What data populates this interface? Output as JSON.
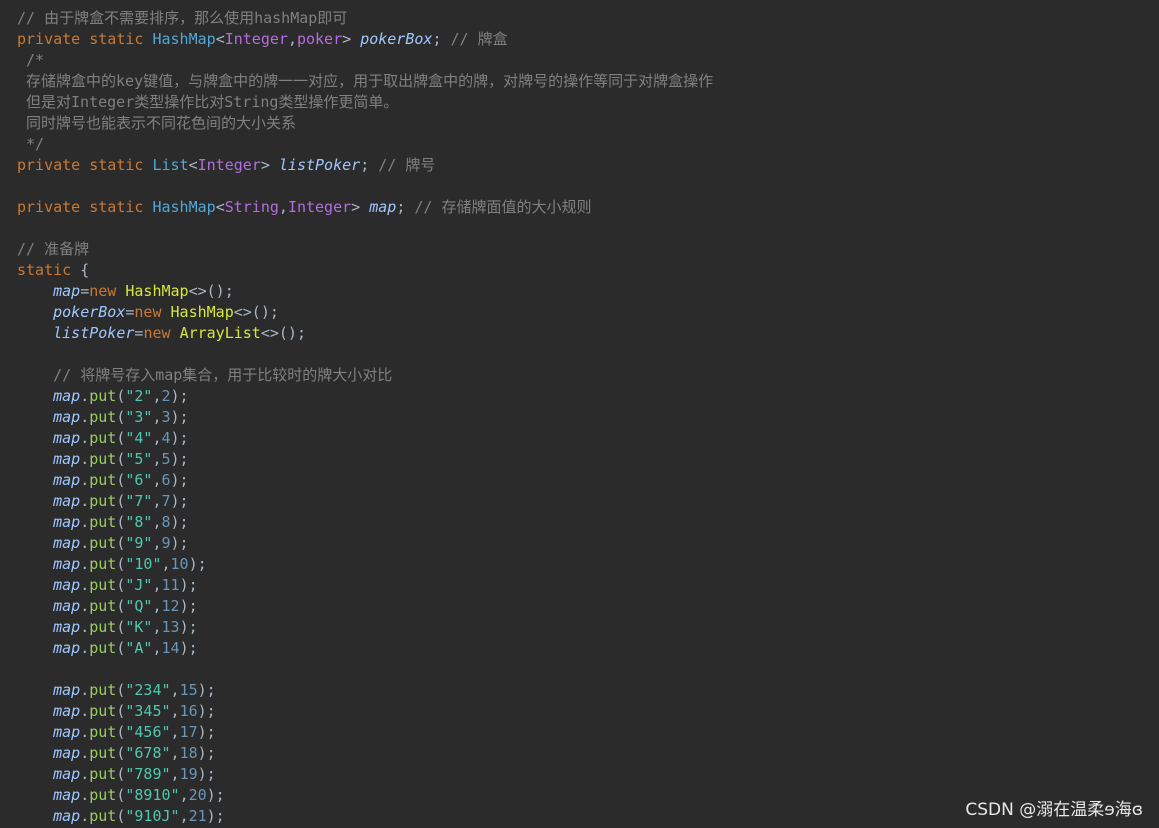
{
  "colors": {
    "background": "#2b2b2b",
    "comment": "#808080",
    "keyword": "#cc7832",
    "type": "#4fa8d8",
    "generic": "#b36ddf",
    "field": "#9fc7ff",
    "method": "#9ccc65",
    "string": "#4ec9b0",
    "number": "#6897bb",
    "ctor": "#d6e83b",
    "plain": "#a9b7c6"
  },
  "watermark": "CSDN @溺在温柔ɘ海ɞ",
  "code_lines": [
    [
      [
        "comment",
        "// 由于牌盒不需要排序，那么使用hashMap即可"
      ]
    ],
    [
      [
        "kw",
        "private static "
      ],
      [
        "type",
        "HashMap"
      ],
      [
        "op",
        "<"
      ],
      [
        "generic",
        "Integer"
      ],
      [
        "op",
        ","
      ],
      [
        "generic",
        "poker"
      ],
      [
        "op",
        "> "
      ],
      [
        "field",
        "pokerBox"
      ],
      [
        "op",
        "; "
      ],
      [
        "comment",
        "// 牌盒"
      ]
    ],
    [
      [
        "comment",
        " /*"
      ]
    ],
    [
      [
        "comment",
        " 存储牌盒中的key键值，与牌盒中的牌一一对应，用于取出牌盒中的牌，对牌号的操作等同于对牌盒操作"
      ]
    ],
    [
      [
        "comment",
        " 但是对Integer类型操作比对String类型操作更简单。"
      ]
    ],
    [
      [
        "comment",
        " 同时牌号也能表示不同花色间的大小关系"
      ]
    ],
    [
      [
        "comment",
        " */"
      ]
    ],
    [
      [
        "kw",
        "private static "
      ],
      [
        "type",
        "List"
      ],
      [
        "op",
        "<"
      ],
      [
        "generic",
        "Integer"
      ],
      [
        "op",
        "> "
      ],
      [
        "field",
        "listPoker"
      ],
      [
        "op",
        "; "
      ],
      [
        "comment",
        "// 牌号"
      ]
    ],
    [],
    [
      [
        "kw",
        "private static "
      ],
      [
        "type",
        "HashMap"
      ],
      [
        "op",
        "<"
      ],
      [
        "generic",
        "String"
      ],
      [
        "op",
        ","
      ],
      [
        "generic",
        "Integer"
      ],
      [
        "op",
        "> "
      ],
      [
        "field",
        "map"
      ],
      [
        "op",
        "; "
      ],
      [
        "comment",
        "// 存储牌面值的大小规则"
      ]
    ],
    [],
    [
      [
        "comment",
        "// 准备牌"
      ]
    ],
    [
      [
        "kw",
        "static "
      ],
      [
        "op",
        "{"
      ]
    ],
    [
      [
        "op",
        "    "
      ],
      [
        "field",
        "map"
      ],
      [
        "op",
        "="
      ],
      [
        "kw",
        "new "
      ],
      [
        "ctor",
        "HashMap"
      ],
      [
        "op",
        "<>();"
      ]
    ],
    [
      [
        "op",
        "    "
      ],
      [
        "field",
        "pokerBox"
      ],
      [
        "op",
        "="
      ],
      [
        "kw",
        "new "
      ],
      [
        "ctor",
        "HashMap"
      ],
      [
        "op",
        "<>();"
      ]
    ],
    [
      [
        "op",
        "    "
      ],
      [
        "field",
        "listPoker"
      ],
      [
        "op",
        "="
      ],
      [
        "kw",
        "new "
      ],
      [
        "ctor",
        "ArrayList"
      ],
      [
        "op",
        "<>();"
      ]
    ],
    [],
    [
      [
        "op",
        "    "
      ],
      [
        "comment",
        "// 将牌号存入map集合，用于比较时的牌大小对比"
      ]
    ],
    [
      [
        "op",
        "    "
      ],
      [
        "field",
        "map"
      ],
      [
        "op",
        "."
      ],
      [
        "method",
        "put"
      ],
      [
        "op",
        "("
      ],
      [
        "string",
        "\"2\""
      ],
      [
        "op",
        ","
      ],
      [
        "number",
        "2"
      ],
      [
        "op",
        ");"
      ]
    ],
    [
      [
        "op",
        "    "
      ],
      [
        "field",
        "map"
      ],
      [
        "op",
        "."
      ],
      [
        "method",
        "put"
      ],
      [
        "op",
        "("
      ],
      [
        "string",
        "\"3\""
      ],
      [
        "op",
        ","
      ],
      [
        "number",
        "3"
      ],
      [
        "op",
        ");"
      ]
    ],
    [
      [
        "op",
        "    "
      ],
      [
        "field",
        "map"
      ],
      [
        "op",
        "."
      ],
      [
        "method",
        "put"
      ],
      [
        "op",
        "("
      ],
      [
        "string",
        "\"4\""
      ],
      [
        "op",
        ","
      ],
      [
        "number",
        "4"
      ],
      [
        "op",
        ");"
      ]
    ],
    [
      [
        "op",
        "    "
      ],
      [
        "field",
        "map"
      ],
      [
        "op",
        "."
      ],
      [
        "method",
        "put"
      ],
      [
        "op",
        "("
      ],
      [
        "string",
        "\"5\""
      ],
      [
        "op",
        ","
      ],
      [
        "number",
        "5"
      ],
      [
        "op",
        ");"
      ]
    ],
    [
      [
        "op",
        "    "
      ],
      [
        "field",
        "map"
      ],
      [
        "op",
        "."
      ],
      [
        "method",
        "put"
      ],
      [
        "op",
        "("
      ],
      [
        "string",
        "\"6\""
      ],
      [
        "op",
        ","
      ],
      [
        "number",
        "6"
      ],
      [
        "op",
        ");"
      ]
    ],
    [
      [
        "op",
        "    "
      ],
      [
        "field",
        "map"
      ],
      [
        "op",
        "."
      ],
      [
        "method",
        "put"
      ],
      [
        "op",
        "("
      ],
      [
        "string",
        "\"7\""
      ],
      [
        "op",
        ","
      ],
      [
        "number",
        "7"
      ],
      [
        "op",
        ");"
      ]
    ],
    [
      [
        "op",
        "    "
      ],
      [
        "field",
        "map"
      ],
      [
        "op",
        "."
      ],
      [
        "method",
        "put"
      ],
      [
        "op",
        "("
      ],
      [
        "string",
        "\"8\""
      ],
      [
        "op",
        ","
      ],
      [
        "number",
        "8"
      ],
      [
        "op",
        ");"
      ]
    ],
    [
      [
        "op",
        "    "
      ],
      [
        "field",
        "map"
      ],
      [
        "op",
        "."
      ],
      [
        "method",
        "put"
      ],
      [
        "op",
        "("
      ],
      [
        "string",
        "\"9\""
      ],
      [
        "op",
        ","
      ],
      [
        "number",
        "9"
      ],
      [
        "op",
        ");"
      ]
    ],
    [
      [
        "op",
        "    "
      ],
      [
        "field",
        "map"
      ],
      [
        "op",
        "."
      ],
      [
        "method",
        "put"
      ],
      [
        "op",
        "("
      ],
      [
        "string",
        "\"10\""
      ],
      [
        "op",
        ","
      ],
      [
        "number",
        "10"
      ],
      [
        "op",
        ");"
      ]
    ],
    [
      [
        "op",
        "    "
      ],
      [
        "field",
        "map"
      ],
      [
        "op",
        "."
      ],
      [
        "method",
        "put"
      ],
      [
        "op",
        "("
      ],
      [
        "string",
        "\"J\""
      ],
      [
        "op",
        ","
      ],
      [
        "number",
        "11"
      ],
      [
        "op",
        ");"
      ]
    ],
    [
      [
        "op",
        "    "
      ],
      [
        "field",
        "map"
      ],
      [
        "op",
        "."
      ],
      [
        "method",
        "put"
      ],
      [
        "op",
        "("
      ],
      [
        "string",
        "\"Q\""
      ],
      [
        "op",
        ","
      ],
      [
        "number",
        "12"
      ],
      [
        "op",
        ");"
      ]
    ],
    [
      [
        "op",
        "    "
      ],
      [
        "field",
        "map"
      ],
      [
        "op",
        "."
      ],
      [
        "method",
        "put"
      ],
      [
        "op",
        "("
      ],
      [
        "string",
        "\"K\""
      ],
      [
        "op",
        ","
      ],
      [
        "number",
        "13"
      ],
      [
        "op",
        ");"
      ]
    ],
    [
      [
        "op",
        "    "
      ],
      [
        "field",
        "map"
      ],
      [
        "op",
        "."
      ],
      [
        "method",
        "put"
      ],
      [
        "op",
        "("
      ],
      [
        "string",
        "\"A\""
      ],
      [
        "op",
        ","
      ],
      [
        "number",
        "14"
      ],
      [
        "op",
        ");"
      ]
    ],
    [],
    [
      [
        "op",
        "    "
      ],
      [
        "field",
        "map"
      ],
      [
        "op",
        "."
      ],
      [
        "method",
        "put"
      ],
      [
        "op",
        "("
      ],
      [
        "string",
        "\"234\""
      ],
      [
        "op",
        ","
      ],
      [
        "number",
        "15"
      ],
      [
        "op",
        ");"
      ]
    ],
    [
      [
        "op",
        "    "
      ],
      [
        "field",
        "map"
      ],
      [
        "op",
        "."
      ],
      [
        "method",
        "put"
      ],
      [
        "op",
        "("
      ],
      [
        "string",
        "\"345\""
      ],
      [
        "op",
        ","
      ],
      [
        "number",
        "16"
      ],
      [
        "op",
        ");"
      ]
    ],
    [
      [
        "op",
        "    "
      ],
      [
        "field",
        "map"
      ],
      [
        "op",
        "."
      ],
      [
        "method",
        "put"
      ],
      [
        "op",
        "("
      ],
      [
        "string",
        "\"456\""
      ],
      [
        "op",
        ","
      ],
      [
        "number",
        "17"
      ],
      [
        "op",
        ");"
      ]
    ],
    [
      [
        "op",
        "    "
      ],
      [
        "field",
        "map"
      ],
      [
        "op",
        "."
      ],
      [
        "method",
        "put"
      ],
      [
        "op",
        "("
      ],
      [
        "string",
        "\"678\""
      ],
      [
        "op",
        ","
      ],
      [
        "number",
        "18"
      ],
      [
        "op",
        ");"
      ]
    ],
    [
      [
        "op",
        "    "
      ],
      [
        "field",
        "map"
      ],
      [
        "op",
        "."
      ],
      [
        "method",
        "put"
      ],
      [
        "op",
        "("
      ],
      [
        "string",
        "\"789\""
      ],
      [
        "op",
        ","
      ],
      [
        "number",
        "19"
      ],
      [
        "op",
        ");"
      ]
    ],
    [
      [
        "op",
        "    "
      ],
      [
        "field",
        "map"
      ],
      [
        "op",
        "."
      ],
      [
        "method",
        "put"
      ],
      [
        "op",
        "("
      ],
      [
        "string",
        "\"8910\""
      ],
      [
        "op",
        ","
      ],
      [
        "number",
        "20"
      ],
      [
        "op",
        ");"
      ]
    ],
    [
      [
        "op",
        "    "
      ],
      [
        "field",
        "map"
      ],
      [
        "op",
        "."
      ],
      [
        "method",
        "put"
      ],
      [
        "op",
        "("
      ],
      [
        "string",
        "\"910J\""
      ],
      [
        "op",
        ","
      ],
      [
        "number",
        "21"
      ],
      [
        "op",
        ");"
      ]
    ]
  ]
}
